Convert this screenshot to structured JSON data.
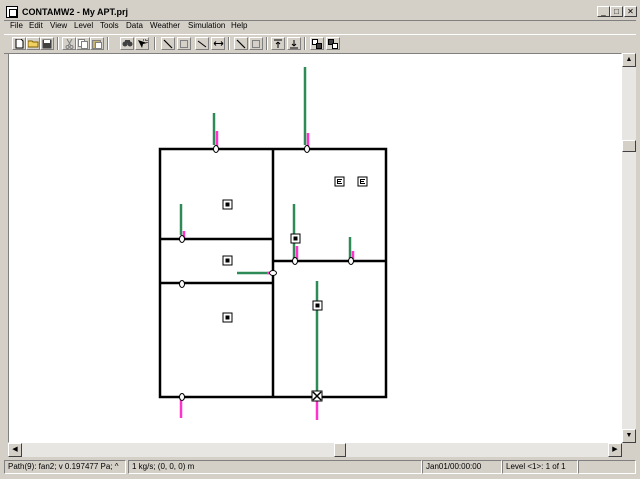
{
  "window": {
    "title": "CONTAMW2 - My APT.prj",
    "min_glyph": "_",
    "max_glyph": "□",
    "close_glyph": "✕"
  },
  "menu": {
    "items": [
      "File",
      "Edit",
      "View",
      "Level",
      "Tools",
      "Data",
      "Weather",
      "Simulation",
      "Help"
    ]
  },
  "toolbar": {
    "icons": [
      "new-icon",
      "open-icon",
      "save-icon",
      "cut-icon",
      "copy-icon",
      "paste-icon",
      "find-icon",
      "select-icon",
      "draw-wall-icon",
      "draw-box-icon",
      "diagonal-line-icon",
      "horizontal-arrow-icon",
      "line-icon",
      "rectangle-icon",
      "level-up-icon",
      "level-down-icon",
      "view-icon-1",
      "view-icon-2"
    ]
  },
  "scrollbars": {
    "up": "▲",
    "down": "▼",
    "left": "◀",
    "right": "▶"
  },
  "status": {
    "path": "Path(9): fan2; v 0.197477 Pa; ^",
    "flow": "1 kg/s; (0, 0, 0) m",
    "datetime": "Jan01/00:00:00",
    "level": "Level <1>: 1 of 1"
  },
  "colors": {
    "wall": "#000000",
    "path_green": "#2e8b57",
    "path_magenta": "#ff33cc"
  }
}
